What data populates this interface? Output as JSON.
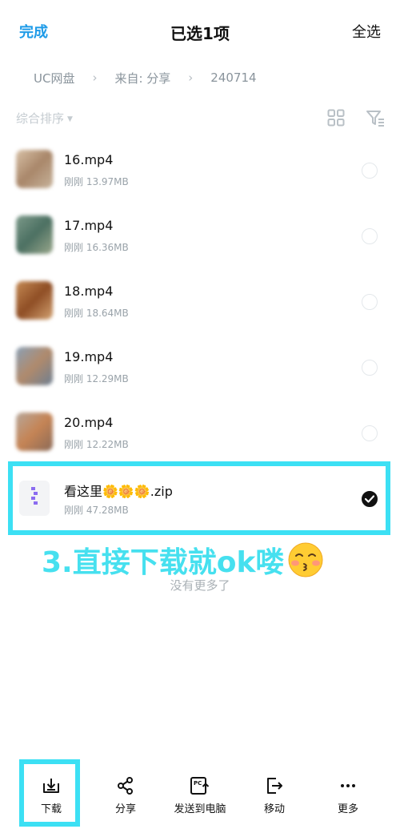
{
  "header": {
    "left_label": "完成",
    "title": "已选1项",
    "right_label": "全选"
  },
  "breadcrumb": [
    "UC网盘",
    "来自: 分享",
    "240714"
  ],
  "toolbar": {
    "sort_label": "综合排序",
    "grid_icon": "grid-view-icon",
    "filter_icon": "filter-icon"
  },
  "files": [
    {
      "name": "16.mp4",
      "meta": "刚刚 13.97MB",
      "selected": false,
      "type": "video"
    },
    {
      "name": "17.mp4",
      "meta": "刚刚 16.36MB",
      "selected": false,
      "type": "video"
    },
    {
      "name": "18.mp4",
      "meta": "刚刚 18.64MB",
      "selected": false,
      "type": "video"
    },
    {
      "name": "19.mp4",
      "meta": "刚刚 12.29MB",
      "selected": false,
      "type": "video"
    },
    {
      "name": "20.mp4",
      "meta": "刚刚 12.22MB",
      "selected": false,
      "type": "video"
    },
    {
      "name": "看这里🌼🌼🌼.zip",
      "meta": "刚刚 47.28MB",
      "selected": true,
      "type": "zip"
    }
  ],
  "annotation": "3.直接下载就ok喽",
  "empty_hint": "没有更多了",
  "bottom_bar": [
    {
      "label": "下载",
      "icon": "download-icon"
    },
    {
      "label": "分享",
      "icon": "share-icon"
    },
    {
      "label": "发送到电脑",
      "icon": "send-to-pc-icon"
    },
    {
      "label": "移动",
      "icon": "move-icon"
    },
    {
      "label": "更多",
      "icon": "more-icon"
    }
  ],
  "colors": {
    "accent": "#1e9be8",
    "highlight": "#3ce0f4",
    "annotation": "#46e0ef"
  }
}
